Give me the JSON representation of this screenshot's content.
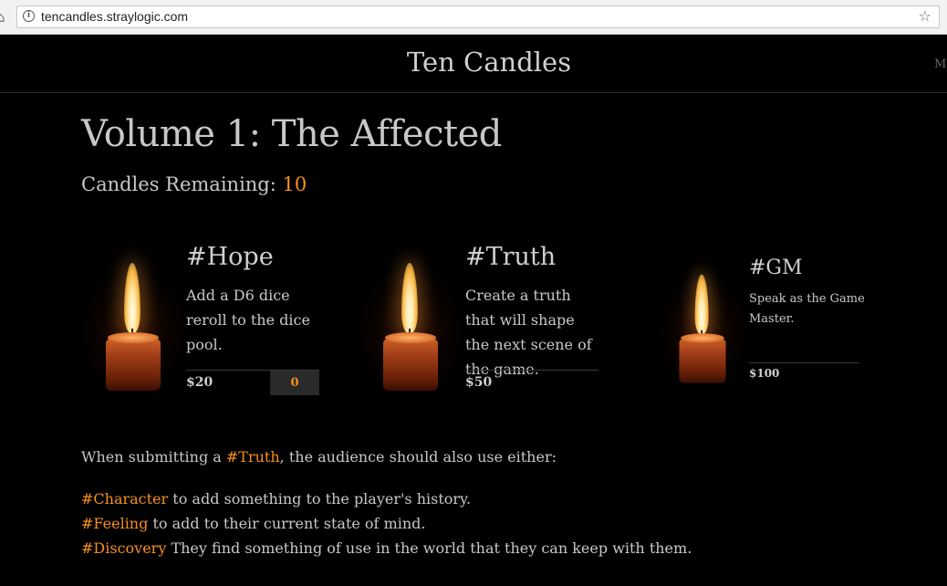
{
  "browser": {
    "url": "tencandles.straylogic.com",
    "icons": {
      "info": "info-icon",
      "bookmark": "star-icon",
      "back": "back-arrow-icon"
    }
  },
  "site": {
    "title": "Ten Candles",
    "menu_partial": "Me"
  },
  "page": {
    "title": "Volume 1: The Affected",
    "candles_remaining_label": "Candles Remaining: ",
    "candles_remaining_value": "10"
  },
  "cards": [
    {
      "tag": "#Hope",
      "description": "Add a D6 dice reroll to the dice pool.",
      "price": "$20",
      "count": "0"
    },
    {
      "tag": "#Truth",
      "description": "Create a truth that will shape the next scene of the game.",
      "price": "$50"
    },
    {
      "tag": "#GM",
      "description": "Speak as the Game Master.",
      "price": "$100"
    }
  ],
  "info": {
    "intro_before": "When submitting a ",
    "intro_tag": "#Truth",
    "intro_after": ", the audience should also use either:",
    "items": [
      {
        "tag": "#Character",
        "text": " to add something to the player's history."
      },
      {
        "tag": "#Feeling",
        "text": " to add to their current state of mind."
      },
      {
        "tag": "#Discovery",
        "text": " They find something of use in the world that they can keep with them."
      }
    ]
  },
  "colors": {
    "accent": "#f5901e",
    "background": "#000000",
    "text": "#c8c8c8"
  }
}
